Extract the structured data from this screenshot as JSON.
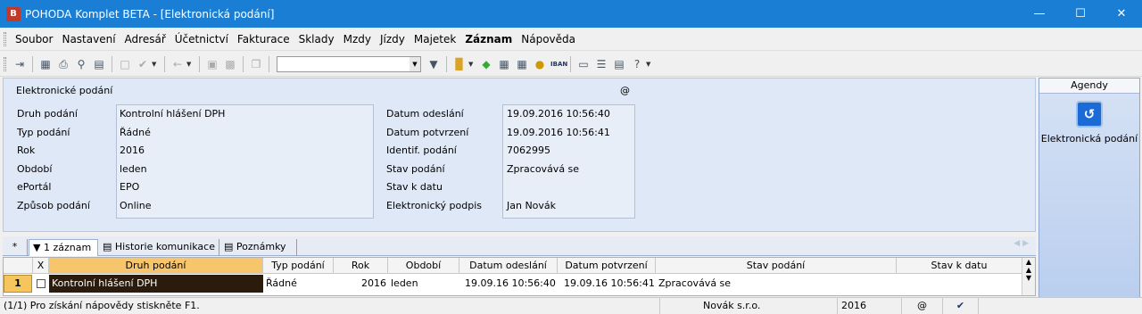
{
  "window": {
    "title": "POHODA Komplet BETA - [Elektronická podání]",
    "app_icon": "pohoda-logo",
    "accent": "#1a7fd4"
  },
  "menu": [
    "Soubor",
    "Nastavení",
    "Adresář",
    "Účetnictví",
    "Fakturace",
    "Sklady",
    "Mzdy",
    "Jízdy",
    "Majetek",
    "Záznam",
    "Nápověda"
  ],
  "toolbar": {
    "search_value": ""
  },
  "detail": {
    "title": "Elektronické podání",
    "at_symbol": "@",
    "left": {
      "labels": [
        "Druh podání",
        "Typ podání",
        "Rok",
        "Období",
        "ePortál",
        "Způsob podání"
      ],
      "values": [
        "Kontrolní hlášení DPH",
        "Řádné",
        "2016",
        "leden",
        "EPO",
        "Online"
      ]
    },
    "right": {
      "labels": [
        "Datum odeslání",
        "Datum potvrzení",
        "Identif. podání",
        "Stav podání",
        "Stav k datu",
        "Elektronický podpis"
      ],
      "values": [
        "19.09.2016 10:56:40",
        "19.09.2016 10:56:41",
        "7062995",
        "Zpracovává se",
        "",
        "Jan Novák"
      ]
    }
  },
  "agendy": {
    "header": "Agendy",
    "item_label": "Elektronická podání"
  },
  "tabs": {
    "star": "*",
    "records": "1 záznam",
    "history": "Historie komunikace",
    "notes": "Poznámky"
  },
  "grid": {
    "headers": [
      "X",
      "Druh podání",
      "Typ podání",
      "Rok",
      "Období",
      "Datum odeslání",
      "Datum potvrzení",
      "Stav podání",
      "Stav k datu"
    ],
    "row": {
      "num": "1",
      "druh": "Kontrolní hlášení DPH",
      "typ": "Řádné",
      "rok": "2016",
      "obdobi": "leden",
      "odeslani": "19.09.16 10:56:40",
      "potvrzeni": "19.09.16 10:56:41",
      "stav": "Zpracovává se",
      "stav_k_datu": ""
    }
  },
  "status": {
    "help": "(1/1) Pro získání nápovědy stiskněte F1.",
    "company": "Novák s.r.o.",
    "year": "2016",
    "at": "@"
  }
}
